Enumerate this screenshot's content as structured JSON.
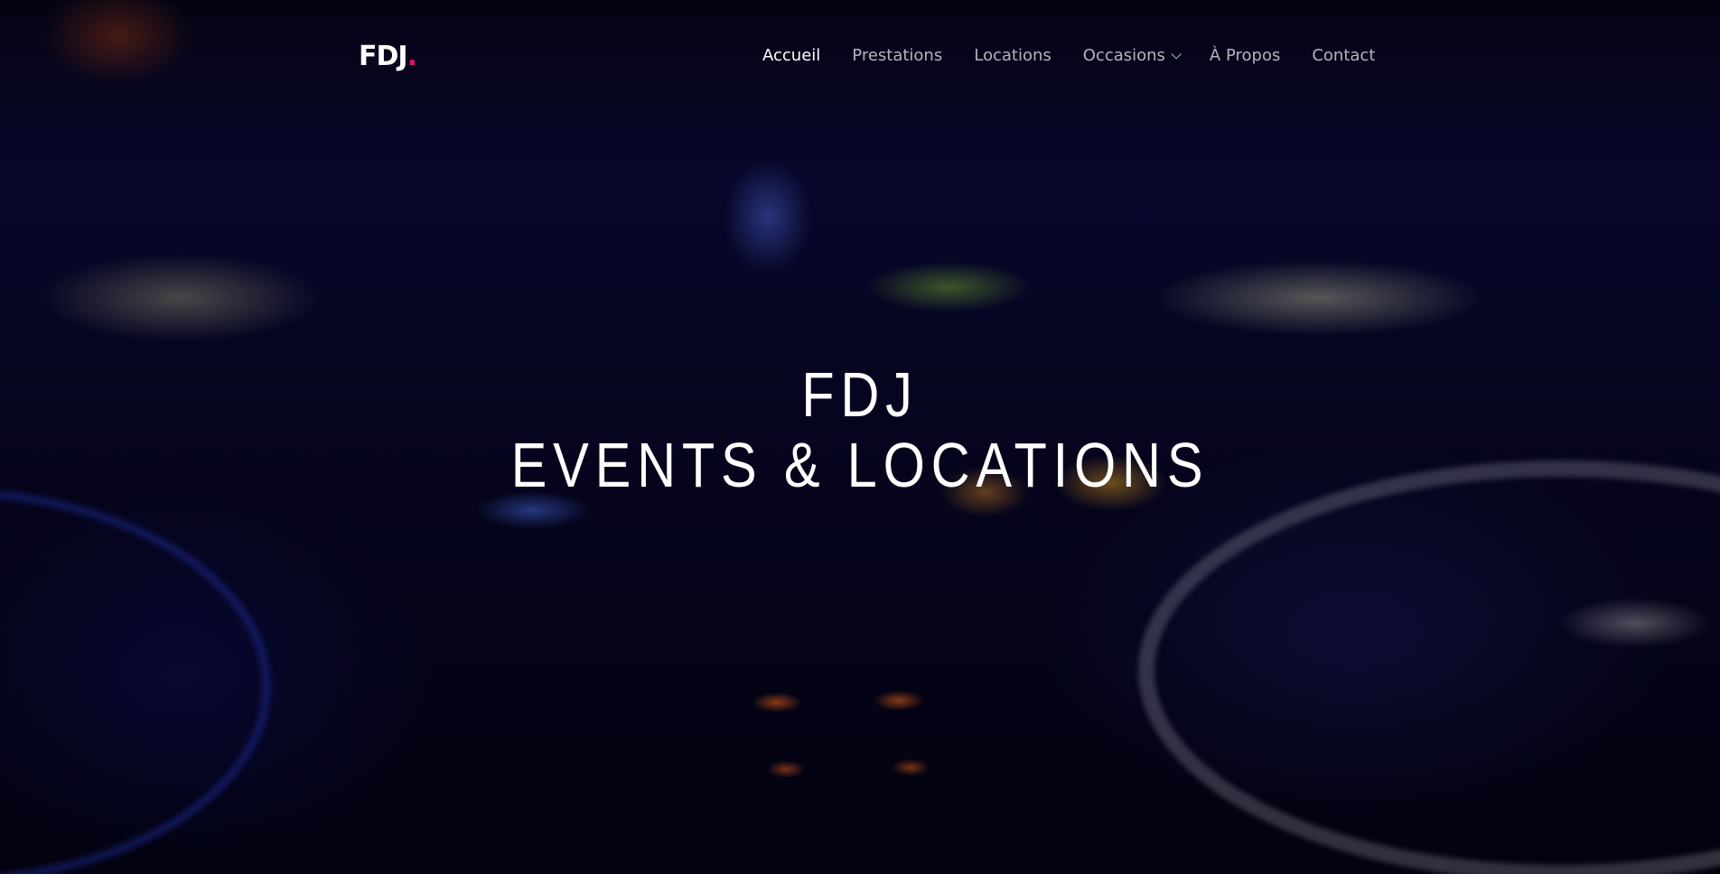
{
  "brand": {
    "name": "FDJ",
    "dot": ".",
    "accent_color": "#e0136c"
  },
  "nav": {
    "items": [
      {
        "label": "Accueil",
        "active": true
      },
      {
        "label": "Prestations",
        "active": false
      },
      {
        "label": "Locations",
        "active": false
      },
      {
        "label": "Occasions",
        "active": false,
        "has_dropdown": true
      },
      {
        "label": "À Propos",
        "active": false
      },
      {
        "label": "Contact",
        "active": false
      }
    ],
    "dropdown_icon": "chevron-down-icon"
  },
  "hero": {
    "line1": "FDJ",
    "line2": "EVENTS & LOCATIONS"
  }
}
